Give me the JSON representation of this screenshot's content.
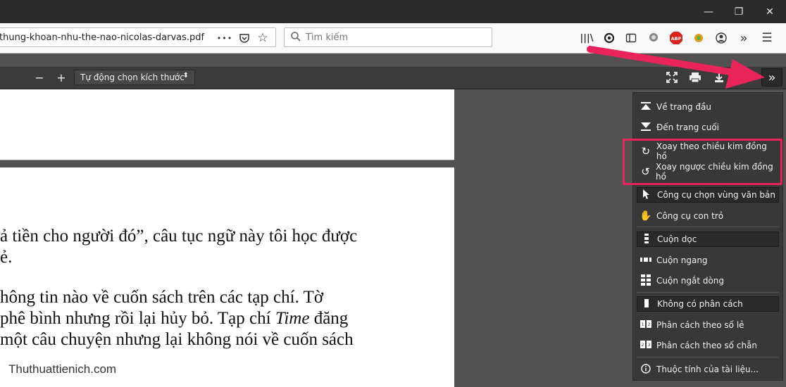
{
  "window": {
    "minimize": "—",
    "restore": "❐",
    "close": "✕"
  },
  "urlbar": {
    "url": "thung-khoan-nhu-the-nao-nicolas-darvas.pdf",
    "more": "•••"
  },
  "search": {
    "placeholder": "Tìm kiếm"
  },
  "pdf_toolbar": {
    "zoom_out": "−",
    "zoom_in": "+",
    "zoom_value": "Tự động chọn kích thước",
    "zoom_arrow": "⬍",
    "tools": "»"
  },
  "document": {
    "line1": "ả tiền cho người đó”, câu tục ngữ này tôi học được",
    "line2": "ẻ.",
    "line3": "hông tin nào về cuốn sách trên các tạp chí. Tờ",
    "line4a": " phê bình nhưng rồi lại hủy bỏ. Tạp chí ",
    "line4b": "Time",
    "line4c": " đăng",
    "line5": " một câu chuyện nhưng lại không nói về cuốn sách",
    "watermark": "Thuthuattienich.com"
  },
  "menu": {
    "first_page": "Về trang đầu",
    "last_page": "Đến trang cuối",
    "rotate_cw": "Xoay theo chiều kim đồng hồ",
    "rotate_ccw": "Xoay ngược chiều kim đồng hồ",
    "text_select": "Công cụ chọn vùng văn bản",
    "hand_tool": "Công cụ con trỏ",
    "vertical_scroll": "Cuộn dọc",
    "horizontal_scroll": "Cuộn ngang",
    "wrapped_scroll": "Cuộn ngắt dòng",
    "no_spreads": "Không có phân cách",
    "odd_spreads": "Phân cách theo số lẻ",
    "even_spreads": "Phân cách theo số chẵn",
    "doc_properties": "Thuộc tính của tài liệu..."
  },
  "colors": {
    "annotation": "#e8245a"
  }
}
